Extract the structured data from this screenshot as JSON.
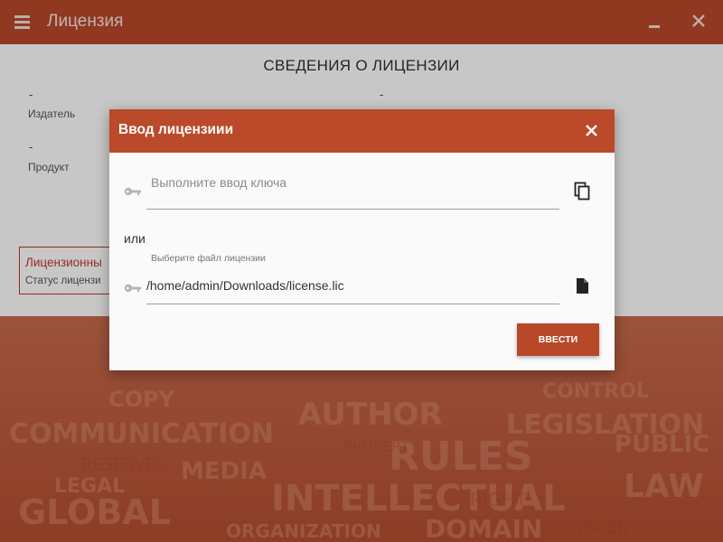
{
  "app": {
    "title": "Лицензия"
  },
  "page": {
    "heading": "СВЕДЕНИЯ О ЛИЦЕНЗИИ",
    "publisher_value": "-",
    "publisher_label": "Издатель",
    "product_value": "-",
    "product_label": "Продукт",
    "right_value": "-",
    "status_title": "Лицензионны",
    "status_subtitle": "Статус лицензи"
  },
  "dialog": {
    "title": "Ввод лицензиии",
    "key_placeholder": "Выполните ввод ключа",
    "or_label": "или",
    "file_label": "Выберите файл лицензии",
    "file_value": "/home/admin/Downloads/license.lic",
    "submit_label": "ВВЕСТИ"
  },
  "icons": {
    "menu": "menu-icon",
    "minimize": "minimize-icon",
    "close": "close-icon",
    "key": "key-icon",
    "paste": "paste-icon",
    "file": "file-icon"
  },
  "colors": {
    "accent": "#ba4a2a",
    "background_pattern": "#c46547",
    "status_border": "#c0392b"
  }
}
